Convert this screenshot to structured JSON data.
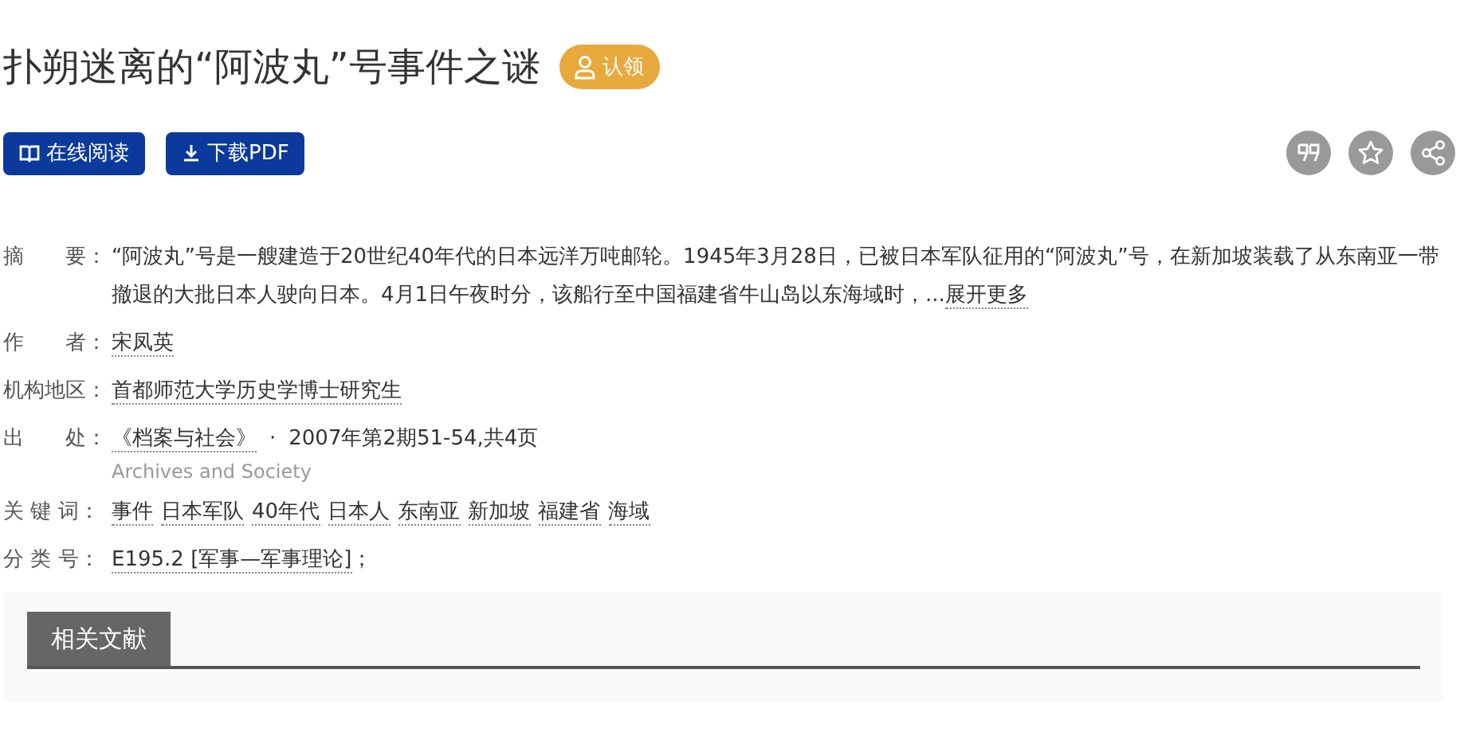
{
  "title": "扑朔迷离的“阿波丸”号事件之谜",
  "claim_badge": "认领",
  "actions": [
    {
      "kind": "read",
      "label": "在线阅读"
    },
    {
      "kind": "download",
      "label": "下载PDF"
    }
  ],
  "tools": [
    {
      "kind": "quote"
    },
    {
      "kind": "star"
    },
    {
      "kind": "share"
    }
  ],
  "abstract": {
    "label": "摘　　要：",
    "text": "“阿波丸”号是一艘建造于20世纪40年代的日本远洋万吨邮轮。1945年3月28日，已被日本军队征用的“阿波丸”号，在新加坡装载了从东南亚一带撤退的大批日本人驶向日本。4月1日午夜时分，该船行至中国福建省牛山岛以东海域时，...",
    "more": "展开更多"
  },
  "author": {
    "label": "作　　者：",
    "value": "宋凤英"
  },
  "institution": {
    "label": "机构地区：",
    "value": "首都师范大学历史学博士研究生"
  },
  "source": {
    "label": "出　　处：",
    "journal": "《档案与社会》",
    "separator": "·",
    "issue": "2007年第2期51-54,共4页",
    "journal_en": "Archives and Society"
  },
  "keywords": {
    "label": "关 键 词：",
    "items": [
      "事件",
      "日本军队",
      "40年代",
      "日本人",
      "东南亚",
      "新加坡",
      "福建省",
      "海域"
    ]
  },
  "classification": {
    "label": "分 类 号：",
    "value": "E195.2 [军事—军事理论]",
    "suffix": "；"
  },
  "related": {
    "tab": "相关文献"
  }
}
